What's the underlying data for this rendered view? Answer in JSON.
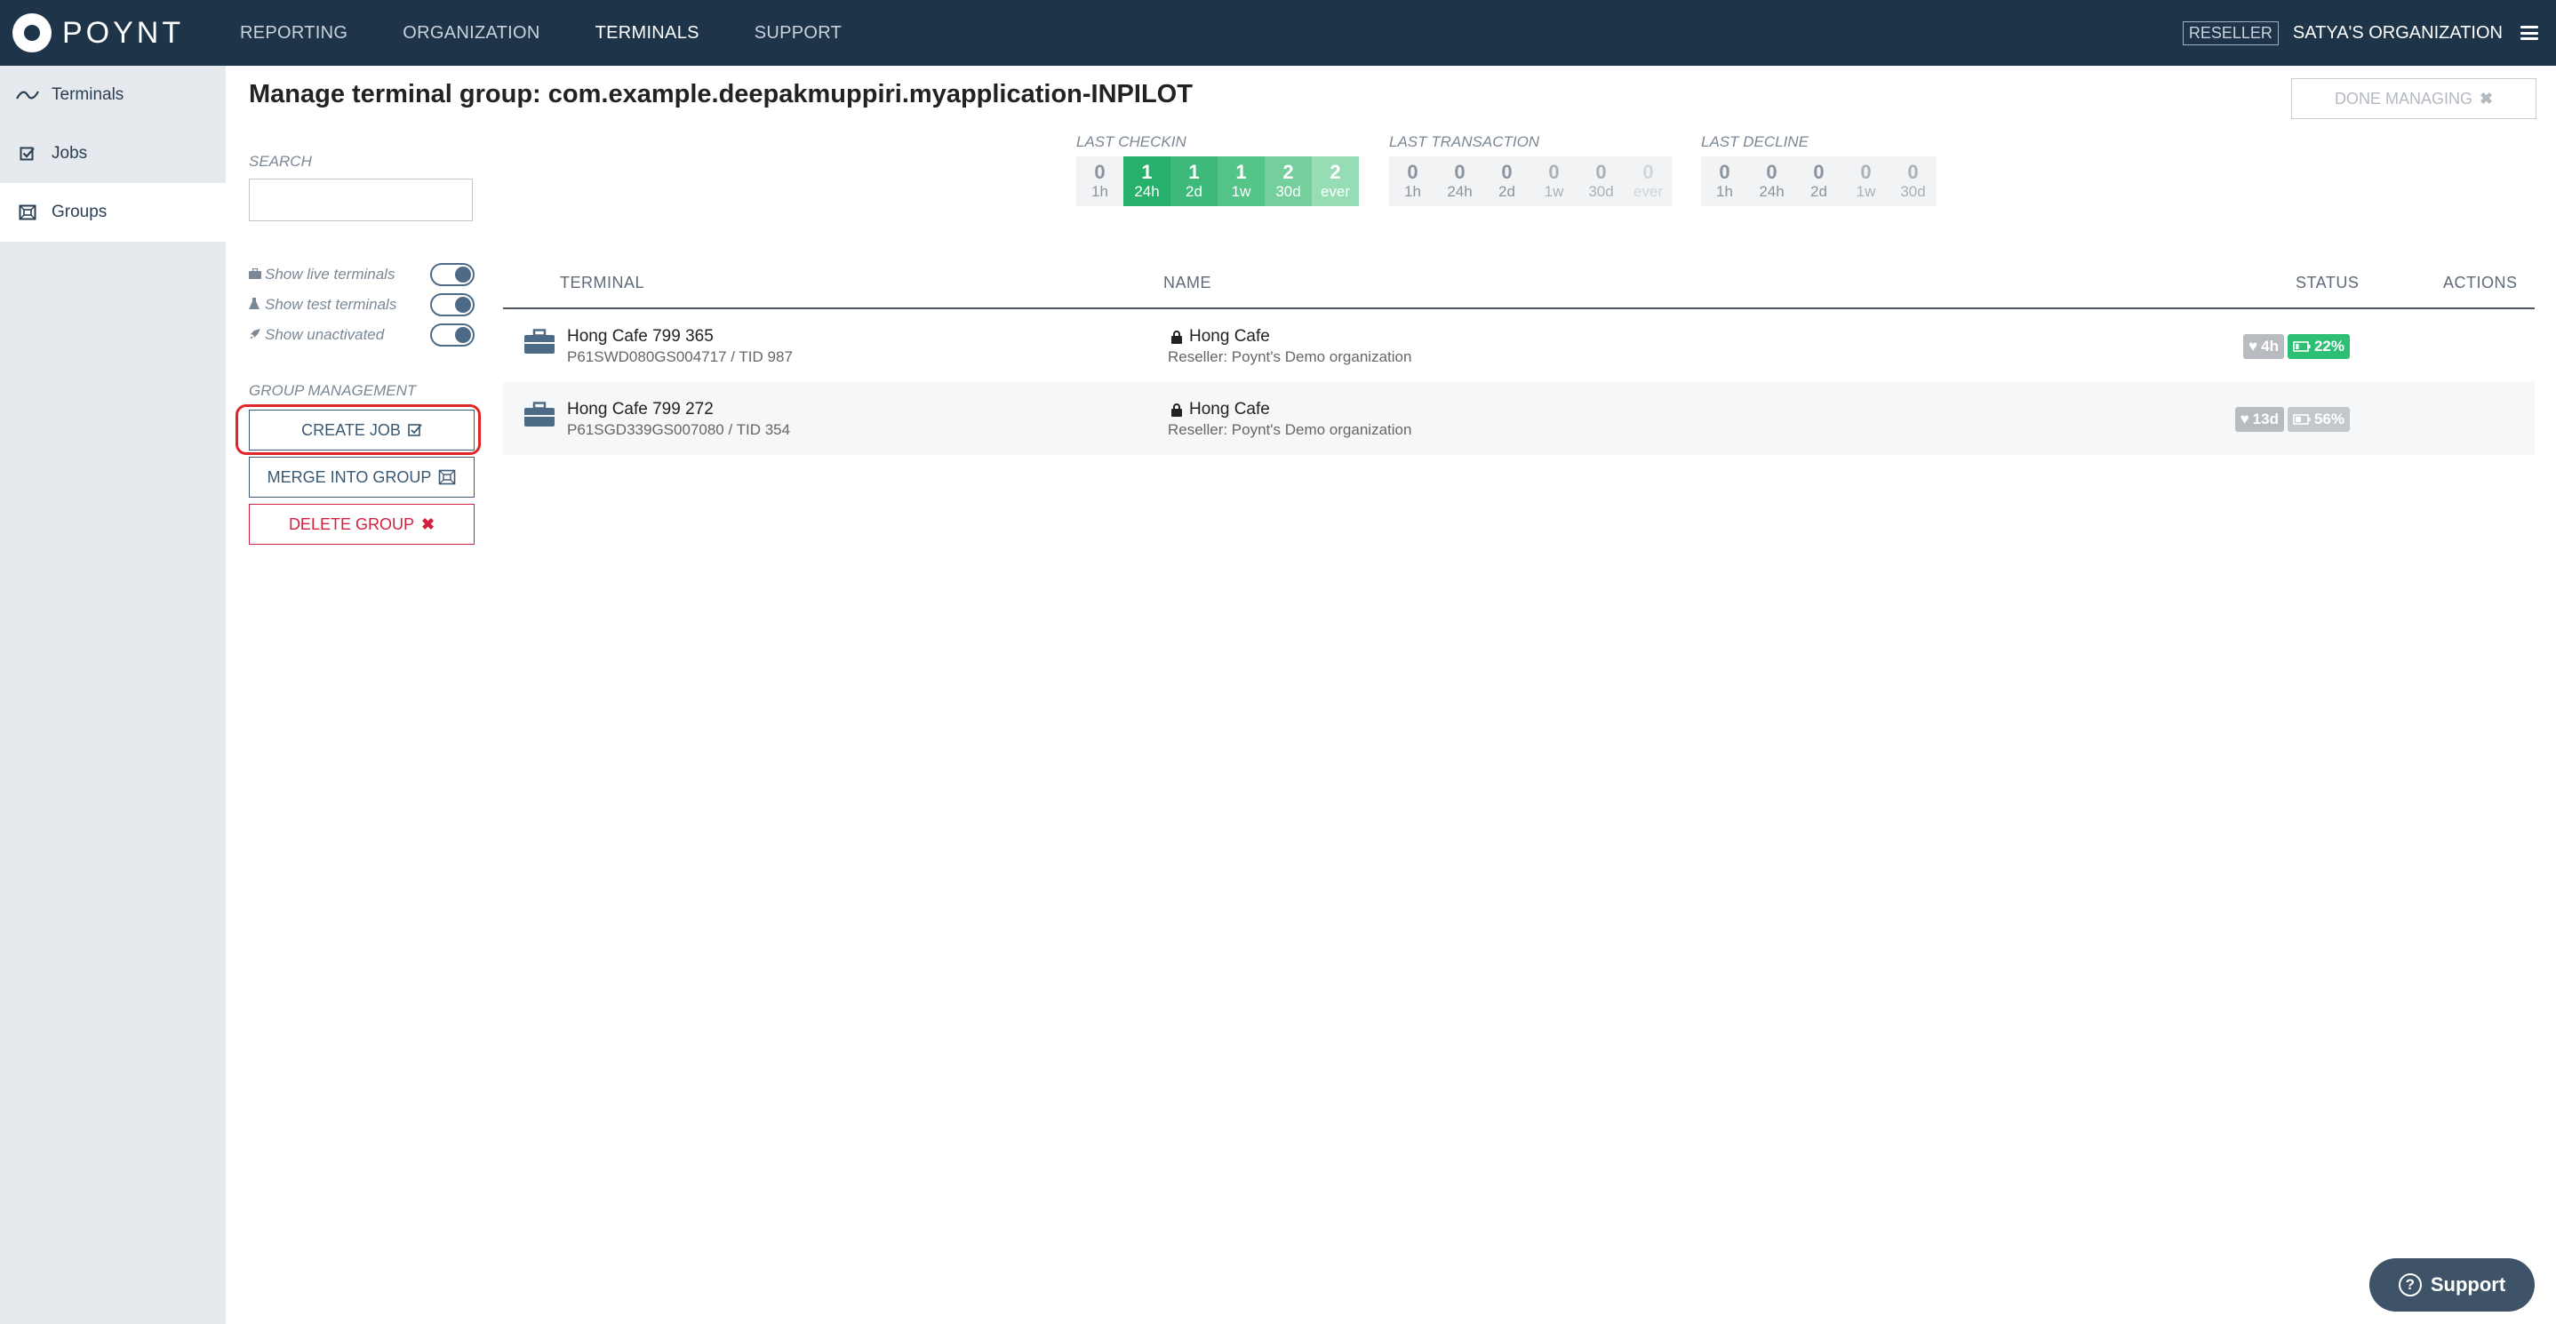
{
  "topbar": {
    "brand": "POYNT",
    "nav": [
      "REPORTING",
      "ORGANIZATION",
      "TERMINALS",
      "SUPPORT"
    ],
    "active_nav": "TERMINALS",
    "reseller_badge": "RESELLER",
    "org_name": "SATYA'S ORGANIZATION"
  },
  "sidebar": {
    "items": [
      {
        "label": "Terminals",
        "icon": "signal-icon"
      },
      {
        "label": "Jobs",
        "icon": "checkbox-icon"
      },
      {
        "label": "Groups",
        "icon": "group-icon"
      }
    ],
    "active": "Groups"
  },
  "main": {
    "title": "Manage terminal group: com.example.deepakmuppiri.myapplication-INPILOT",
    "done_button": "DONE MANAGING",
    "search_label": "SEARCH",
    "search_value": ""
  },
  "stats": {
    "last_checkin": {
      "title": "LAST CHECKIN",
      "cells": [
        {
          "num": "0",
          "label": "1h"
        },
        {
          "num": "1",
          "label": "24h"
        },
        {
          "num": "1",
          "label": "2d"
        },
        {
          "num": "1",
          "label": "1w"
        },
        {
          "num": "2",
          "label": "30d"
        },
        {
          "num": "2",
          "label": "ever"
        }
      ]
    },
    "last_transaction": {
      "title": "LAST TRANSACTION",
      "cells": [
        {
          "num": "0",
          "label": "1h"
        },
        {
          "num": "0",
          "label": "24h"
        },
        {
          "num": "0",
          "label": "2d"
        },
        {
          "num": "0",
          "label": "1w"
        },
        {
          "num": "0",
          "label": "30d"
        },
        {
          "num": "0",
          "label": "ever"
        }
      ]
    },
    "last_decline": {
      "title": "LAST DECLINE",
      "cells": [
        {
          "num": "0",
          "label": "1h"
        },
        {
          "num": "0",
          "label": "24h"
        },
        {
          "num": "0",
          "label": "2d"
        },
        {
          "num": "0",
          "label": "1w"
        },
        {
          "num": "0",
          "label": "30d"
        }
      ]
    }
  },
  "toggles": [
    {
      "label": "Show live terminals",
      "on": true
    },
    {
      "label": "Show test terminals",
      "on": true
    },
    {
      "label": "Show unactivated",
      "on": true
    }
  ],
  "group_management": {
    "label": "GROUP MANAGEMENT",
    "create_job": "CREATE JOB",
    "merge": "MERGE INTO GROUP",
    "delete": "DELETE GROUP"
  },
  "table": {
    "headers": {
      "terminal": "TERMINAL",
      "name": "NAME",
      "status": "STATUS",
      "actions": "ACTIONS"
    },
    "rows": [
      {
        "terminal": "Hong Cafe 799 365",
        "serial": "P61SWD080GS004717 / TID 987",
        "store": "Hong Cafe",
        "reseller": "Reseller: Poynt's Demo organization",
        "heartbeat": "4h",
        "battery": "22%"
      },
      {
        "terminal": "Hong Cafe 799 272",
        "serial": "P61SGD339GS007080 / TID 354",
        "store": "Hong Cafe",
        "reseller": "Reseller: Poynt's Demo organization",
        "heartbeat": "13d",
        "battery": "56%"
      }
    ]
  },
  "support_button": "Support",
  "colors": {
    "topbar": "#1e3448",
    "checkin_green_dark": "#26b06b",
    "checkin_green_mid": "#4cc285",
    "checkin_green_light": "#8fdbb4",
    "highlight_red": "#e0262b",
    "delete_red": "#d4203f"
  }
}
